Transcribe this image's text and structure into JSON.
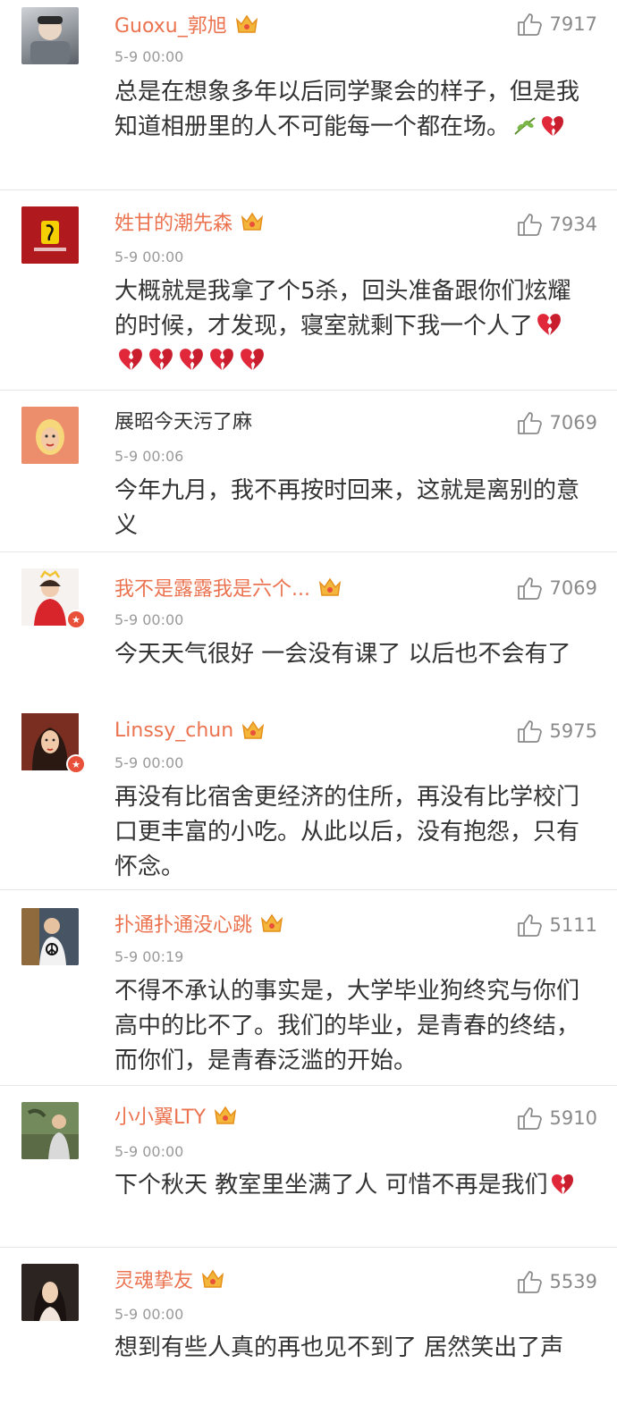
{
  "colors": {
    "username": "#eb7350",
    "plain_username": "#333333",
    "timestamp": "#9a9a9a",
    "text": "#333333",
    "likes": "#8a8a8a"
  },
  "comments": [
    {
      "username": "Guoxu_郭旭",
      "timestamp": "5-9 00:00",
      "likes": "7917",
      "text": "总是在想象多年以后同学聚会的样子，但是我知道相册里的人不可能每一个都在场。",
      "emoji": [
        "leaf-icon",
        "broken-heart-icon"
      ],
      "crown": true
    },
    {
      "username": "姓甘的潮先森",
      "timestamp": "5-9 00:00",
      "likes": "7934",
      "text": "大概就是我拿了个5杀，回头准备跟你们炫耀的时候，才发现，寝室就剩下我一个人了",
      "emoji": [
        "broken-heart-icon",
        "broken-heart-icon",
        "broken-heart-icon",
        "broken-heart-icon",
        "broken-heart-icon",
        "broken-heart-icon"
      ],
      "crown": true
    },
    {
      "username": "展昭今天污了麻",
      "timestamp": "5-9 00:06",
      "likes": "7069",
      "text": "今年九月，我不再按时回来，这就是离别的意义",
      "emoji": [],
      "crown": false
    },
    {
      "username": "我不是露露我是六个...",
      "timestamp": "5-9 00:00",
      "likes": "7069",
      "text": "今天天气很好 一会没有课了 以后也不会有了",
      "emoji": [],
      "crown": true,
      "avatar_badge": true
    },
    {
      "username": "Linssy_chun",
      "timestamp": "5-9 00:00",
      "likes": "5975",
      "text": "再没有比宿舍更经济的住所，再没有比学校门口更丰富的小吃。从此以后，没有抱怨，只有怀念。",
      "emoji": [],
      "crown": true,
      "avatar_badge": true
    },
    {
      "username": "扑通扑通没心跳",
      "timestamp": "5-9 00:19",
      "likes": "5111",
      "text": "不得不承认的事实是，大学毕业狗终究与你们高中的比不了。我们的毕业，是青春的终结，而你们，是青春泛滥的开始。",
      "emoji": [],
      "crown": true
    },
    {
      "username": "小小翼LTY",
      "timestamp": "5-9 00:00",
      "likes": "5910",
      "text": "下个秋天 教室里坐满了人 可惜不再是我们",
      "emoji": [
        "broken-heart-icon"
      ],
      "crown": true
    },
    {
      "username": "灵魂挚友",
      "timestamp": "5-9 00:00",
      "likes": "5539",
      "text": "想到有些人真的再也见不到了 居然笑出了声",
      "emoji": [],
      "crown": true
    }
  ]
}
